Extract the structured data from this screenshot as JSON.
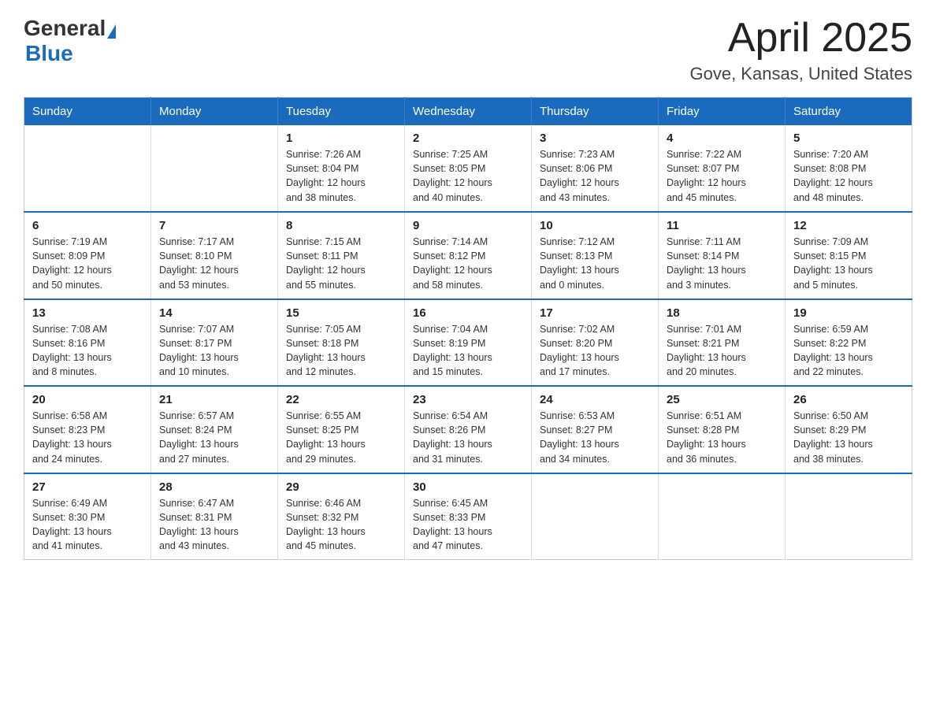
{
  "header": {
    "logo_general": "General",
    "logo_blue": "Blue",
    "title": "April 2025",
    "subtitle": "Gove, Kansas, United States"
  },
  "calendar": {
    "days_of_week": [
      "Sunday",
      "Monday",
      "Tuesday",
      "Wednesday",
      "Thursday",
      "Friday",
      "Saturday"
    ],
    "weeks": [
      [
        {
          "day": "",
          "info": ""
        },
        {
          "day": "",
          "info": ""
        },
        {
          "day": "1",
          "info": "Sunrise: 7:26 AM\nSunset: 8:04 PM\nDaylight: 12 hours\nand 38 minutes."
        },
        {
          "day": "2",
          "info": "Sunrise: 7:25 AM\nSunset: 8:05 PM\nDaylight: 12 hours\nand 40 minutes."
        },
        {
          "day": "3",
          "info": "Sunrise: 7:23 AM\nSunset: 8:06 PM\nDaylight: 12 hours\nand 43 minutes."
        },
        {
          "day": "4",
          "info": "Sunrise: 7:22 AM\nSunset: 8:07 PM\nDaylight: 12 hours\nand 45 minutes."
        },
        {
          "day": "5",
          "info": "Sunrise: 7:20 AM\nSunset: 8:08 PM\nDaylight: 12 hours\nand 48 minutes."
        }
      ],
      [
        {
          "day": "6",
          "info": "Sunrise: 7:19 AM\nSunset: 8:09 PM\nDaylight: 12 hours\nand 50 minutes."
        },
        {
          "day": "7",
          "info": "Sunrise: 7:17 AM\nSunset: 8:10 PM\nDaylight: 12 hours\nand 53 minutes."
        },
        {
          "day": "8",
          "info": "Sunrise: 7:15 AM\nSunset: 8:11 PM\nDaylight: 12 hours\nand 55 minutes."
        },
        {
          "day": "9",
          "info": "Sunrise: 7:14 AM\nSunset: 8:12 PM\nDaylight: 12 hours\nand 58 minutes."
        },
        {
          "day": "10",
          "info": "Sunrise: 7:12 AM\nSunset: 8:13 PM\nDaylight: 13 hours\nand 0 minutes."
        },
        {
          "day": "11",
          "info": "Sunrise: 7:11 AM\nSunset: 8:14 PM\nDaylight: 13 hours\nand 3 minutes."
        },
        {
          "day": "12",
          "info": "Sunrise: 7:09 AM\nSunset: 8:15 PM\nDaylight: 13 hours\nand 5 minutes."
        }
      ],
      [
        {
          "day": "13",
          "info": "Sunrise: 7:08 AM\nSunset: 8:16 PM\nDaylight: 13 hours\nand 8 minutes."
        },
        {
          "day": "14",
          "info": "Sunrise: 7:07 AM\nSunset: 8:17 PM\nDaylight: 13 hours\nand 10 minutes."
        },
        {
          "day": "15",
          "info": "Sunrise: 7:05 AM\nSunset: 8:18 PM\nDaylight: 13 hours\nand 12 minutes."
        },
        {
          "day": "16",
          "info": "Sunrise: 7:04 AM\nSunset: 8:19 PM\nDaylight: 13 hours\nand 15 minutes."
        },
        {
          "day": "17",
          "info": "Sunrise: 7:02 AM\nSunset: 8:20 PM\nDaylight: 13 hours\nand 17 minutes."
        },
        {
          "day": "18",
          "info": "Sunrise: 7:01 AM\nSunset: 8:21 PM\nDaylight: 13 hours\nand 20 minutes."
        },
        {
          "day": "19",
          "info": "Sunrise: 6:59 AM\nSunset: 8:22 PM\nDaylight: 13 hours\nand 22 minutes."
        }
      ],
      [
        {
          "day": "20",
          "info": "Sunrise: 6:58 AM\nSunset: 8:23 PM\nDaylight: 13 hours\nand 24 minutes."
        },
        {
          "day": "21",
          "info": "Sunrise: 6:57 AM\nSunset: 8:24 PM\nDaylight: 13 hours\nand 27 minutes."
        },
        {
          "day": "22",
          "info": "Sunrise: 6:55 AM\nSunset: 8:25 PM\nDaylight: 13 hours\nand 29 minutes."
        },
        {
          "day": "23",
          "info": "Sunrise: 6:54 AM\nSunset: 8:26 PM\nDaylight: 13 hours\nand 31 minutes."
        },
        {
          "day": "24",
          "info": "Sunrise: 6:53 AM\nSunset: 8:27 PM\nDaylight: 13 hours\nand 34 minutes."
        },
        {
          "day": "25",
          "info": "Sunrise: 6:51 AM\nSunset: 8:28 PM\nDaylight: 13 hours\nand 36 minutes."
        },
        {
          "day": "26",
          "info": "Sunrise: 6:50 AM\nSunset: 8:29 PM\nDaylight: 13 hours\nand 38 minutes."
        }
      ],
      [
        {
          "day": "27",
          "info": "Sunrise: 6:49 AM\nSunset: 8:30 PM\nDaylight: 13 hours\nand 41 minutes."
        },
        {
          "day": "28",
          "info": "Sunrise: 6:47 AM\nSunset: 8:31 PM\nDaylight: 13 hours\nand 43 minutes."
        },
        {
          "day": "29",
          "info": "Sunrise: 6:46 AM\nSunset: 8:32 PM\nDaylight: 13 hours\nand 45 minutes."
        },
        {
          "day": "30",
          "info": "Sunrise: 6:45 AM\nSunset: 8:33 PM\nDaylight: 13 hours\nand 47 minutes."
        },
        {
          "day": "",
          "info": ""
        },
        {
          "day": "",
          "info": ""
        },
        {
          "day": "",
          "info": ""
        }
      ]
    ]
  }
}
